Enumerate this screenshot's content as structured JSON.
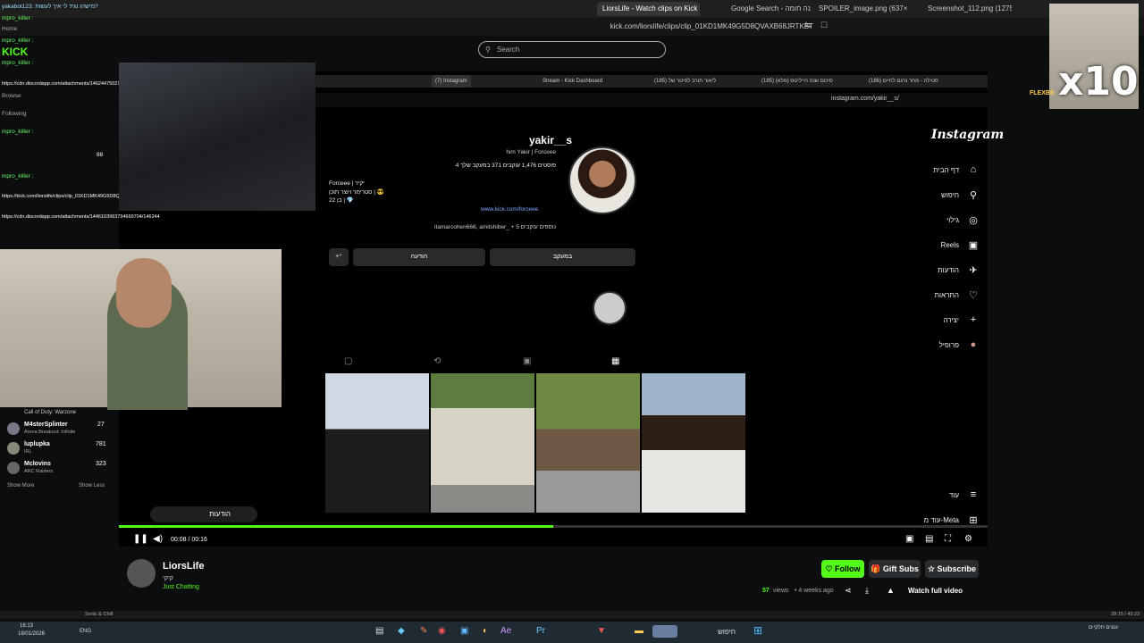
{
  "browser": {
    "tabs": [
      {
        "label": "LiorsLife - Watch clips on Kick",
        "active": true
      },
      {
        "label": "Google Search - בינה חומה"
      },
      {
        "label": "SPOILER_image.png (637×602)"
      },
      {
        "label": "Screenshot_112.png (1275×718)"
      }
    ],
    "url": "kick.com/liorslife/clips/clip_01KD1MK49G5D8QVAXB68JRTKBT",
    "search_placeholder": "Search"
  },
  "inner_browser": {
    "tabs": [
      "(7) Instagram",
      "Stream - Kick Dashboard",
      "(185) ליאור תורב לפיטר של",
      "(185) סיכום שנה הייליטס (מלא)",
      "(186) סטילה - מחר נרגם לחיים"
    ],
    "url": "instagram.com/yakir__s/"
  },
  "instagram": {
    "logo": "Instagram",
    "nav": [
      {
        "label": "דף הבית",
        "icon": "home-icon",
        "glyph": "⌂"
      },
      {
        "label": "חיפוש",
        "icon": "search-icon",
        "glyph": "⚲"
      },
      {
        "label": "גילוי",
        "icon": "compass-icon",
        "glyph": "◎"
      },
      {
        "label": "Reels",
        "icon": "reels-icon",
        "glyph": "▣"
      },
      {
        "label": "הודעות",
        "icon": "messages-icon",
        "glyph": "✈"
      },
      {
        "label": "התראות",
        "icon": "heart-icon",
        "glyph": "♡"
      },
      {
        "label": "יצירה",
        "icon": "plus-icon",
        "glyph": "+"
      },
      {
        "label": "פרופיל",
        "icon": "profile-icon",
        "glyph": "●"
      }
    ],
    "more_label": "עוד",
    "meta_label": "עוד מ-Meta",
    "profile": {
      "username": "yakir__s",
      "subline": "him Yakir | Forceee",
      "stats": "4 פוסטים  1,476 עוקבים  371 במעקב שלך",
      "bio1": "Forceee | יקיר",
      "bio2": "סטרימר ויוצר תוכן | 😎",
      "bio3": "בן 22 | 💎",
      "link": "www.kick.com/forceee",
      "followed_by": "itamarcohen666, amitshiber_ + 5 נוספים עוקבים",
      "follow_btn": "במעקב",
      "message_btn": "הודעה",
      "add_btn": "+⁺"
    },
    "messages_float": "הודעות"
  },
  "chat": {
    "lines": [
      "yakabot123: מישהו נגיד לי איך לעשות?",
      "mpro_killer :",
      "Home",
      "mpro_killer :",
      "KICK",
      "mpro_killer :",
      "Browse",
      "https://cdn.discordapp.com/attachments/1462447502187036893/146244",
      "Following",
      "mpro_killer :",
      "mpro_killer :",
      "https://kick.com/liorslife/clips/clip_01KD1MK49G5D8QVAXB68JRTKBT",
      "https://cdn.discordapp.com/attachments/1446103963794669704/146244"
    ],
    "recommended": [
      {
        "name": "Call of Duty: Warzone",
        "viewers": ""
      },
      {
        "name": "M4sterSplinter",
        "sub": "Arena Breakout: Infinite",
        "viewers": "27"
      },
      {
        "name": "luplupka",
        "sub": "IRL",
        "viewers": "781"
      },
      {
        "name": "Mclovins",
        "sub": "ARC Raiders",
        "viewers": "323"
      }
    ],
    "show_more": "Show More",
    "show_less": "Show Less",
    "count_88": "88"
  },
  "player": {
    "time": "00:08 / 00:16",
    "progress_fraction": 0.5
  },
  "channel": {
    "name": "LiorsLife",
    "sub": "קיקי",
    "category": "Just Chatting",
    "follow": "Follow",
    "gift": "Gift Subs",
    "subscribe": "Subscribe",
    "views": "57",
    "views_label": "views",
    "ago": "• 4 weeks ago",
    "watch_full": "Watch full video"
  },
  "overlay": {
    "x10": "x10",
    "flexbs": "FLEXBS"
  },
  "statusbar": {
    "left": "Sonic & Chill",
    "right": "39:15 / 43:23"
  },
  "taskbar": {
    "time": "16:13",
    "date": "18/01/2026",
    "lang": "ENG",
    "search": "חיפוש",
    "weather": "עננים חלקיים"
  }
}
